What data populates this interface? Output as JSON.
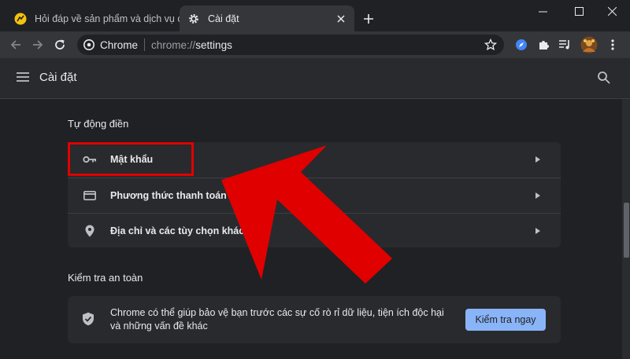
{
  "tabs": [
    {
      "title": "Hỏi đáp về sản phẩm và dịch vụ của",
      "favicon": "sunflower-favicon-icon",
      "active": false
    },
    {
      "title": "Cài đặt",
      "favicon": "gear-icon",
      "active": true
    }
  ],
  "omnibox": {
    "chip": "Chrome",
    "scheme": "chrome://",
    "host": "settings"
  },
  "appbar": {
    "title": "Cài đặt"
  },
  "autofill": {
    "title": "Tự động điền",
    "items": [
      {
        "label": "Mật khẩu",
        "icon": "key-icon"
      },
      {
        "label": "Phương thức thanh toán",
        "icon": "credit-card-icon"
      },
      {
        "label": "Địa chỉ và các tùy chọn khác",
        "icon": "location-pin-icon"
      }
    ]
  },
  "safety": {
    "title": "Kiểm tra an toàn",
    "text": "Chrome có thể giúp bảo vệ bạn trước các sự cố rò rỉ dữ liệu, tiện ích độc hại và những vấn đề khác",
    "button": "Kiểm tra ngay"
  },
  "colors": {
    "accent": "#8ab4f8",
    "highlight": "#e00000",
    "background": "#202124",
    "card": "#292a2d"
  }
}
